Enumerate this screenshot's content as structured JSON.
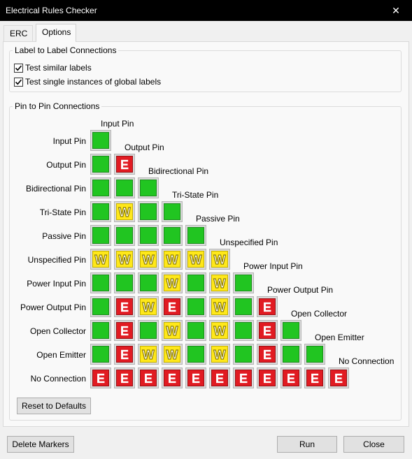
{
  "window": {
    "title": "Electrical Rules Checker",
    "close_glyph": "✕"
  },
  "tabs": [
    {
      "label": "ERC",
      "active": false
    },
    {
      "label": "Options",
      "active": true
    }
  ],
  "label_group": {
    "title": "Label to Label Connections",
    "options": [
      {
        "label": "Test similar labels",
        "checked": true
      },
      {
        "label": "Test single instances of global labels",
        "checked": true
      }
    ]
  },
  "pin_group": {
    "title": "Pin to Pin Connections",
    "pins": [
      "Input Pin",
      "Output Pin",
      "Bidirectional Pin",
      "Tri-State Pin",
      "Passive Pin",
      "Unspecified Pin",
      "Power Input Pin",
      "Power Output Pin",
      "Open Collector",
      "Open Emitter",
      "No Connection"
    ],
    "matrix": [
      [
        "ok"
      ],
      [
        "ok",
        "err"
      ],
      [
        "ok",
        "ok",
        "ok"
      ],
      [
        "ok",
        "warn",
        "ok",
        "ok"
      ],
      [
        "ok",
        "ok",
        "ok",
        "ok",
        "ok"
      ],
      [
        "warn",
        "warn",
        "warn",
        "warn",
        "warn",
        "warn"
      ],
      [
        "ok",
        "ok",
        "ok",
        "warn",
        "ok",
        "warn",
        "ok"
      ],
      [
        "ok",
        "err",
        "warn",
        "err",
        "ok",
        "warn",
        "ok",
        "err"
      ],
      [
        "ok",
        "err",
        "ok",
        "warn",
        "ok",
        "warn",
        "ok",
        "err",
        "ok"
      ],
      [
        "ok",
        "err",
        "warn",
        "warn",
        "ok",
        "warn",
        "ok",
        "err",
        "ok",
        "ok"
      ],
      [
        "err",
        "err",
        "err",
        "err",
        "err",
        "err",
        "err",
        "err",
        "err",
        "err",
        "err"
      ]
    ],
    "symbols": {
      "ok": "",
      "warn": "W",
      "err": "E"
    },
    "reset_button": "Reset to Defaults"
  },
  "footer": {
    "delete_markers": "Delete Markers",
    "run": "Run",
    "close": "Close"
  },
  "colors": {
    "ok": "#21c521",
    "warning": "#ffe81a",
    "error": "#e11b22"
  }
}
